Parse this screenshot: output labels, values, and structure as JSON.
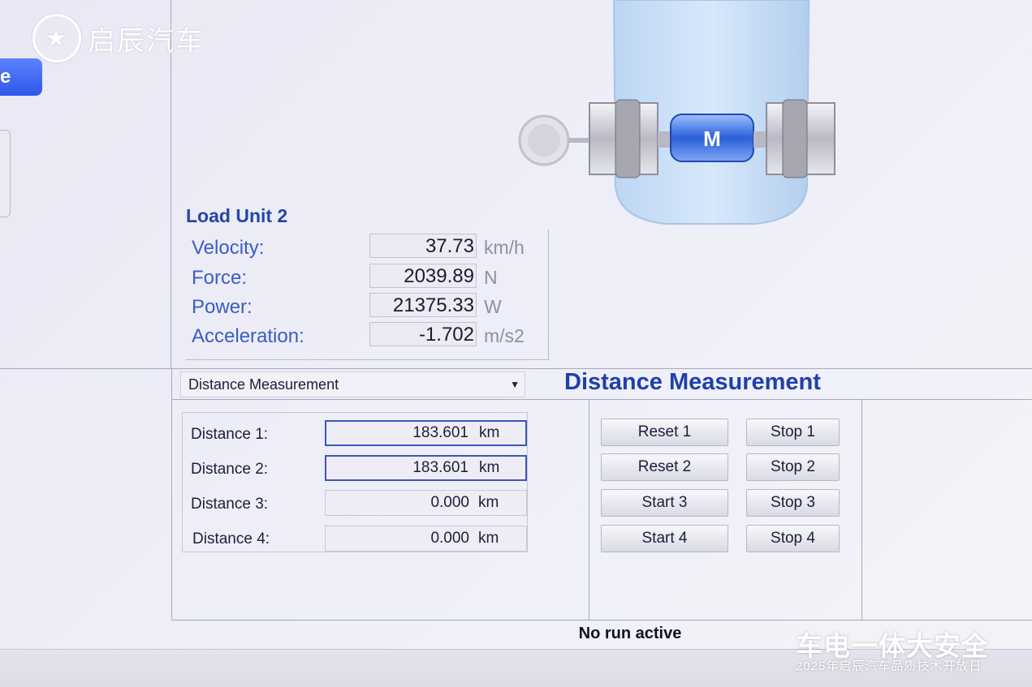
{
  "branding": {
    "logo_text": "启辰汽车",
    "watermark_title": "车电一体大安全",
    "watermark_subtitle": "2025年启辰汽车品质技术开放日"
  },
  "left_panel": {
    "button_partial_label": "e"
  },
  "diagram": {
    "motor_label": "M"
  },
  "load_unit": {
    "title": "Load Unit 2",
    "rows": [
      {
        "label": "Velocity:",
        "value": "37.73",
        "unit": "km/h"
      },
      {
        "label": "Force:",
        "value": "2039.89",
        "unit": "N"
      },
      {
        "label": "Power:",
        "value": "21375.33",
        "unit": "W"
      },
      {
        "label": "Acceleration:",
        "value": "-1.702",
        "unit": "m/s2"
      }
    ]
  },
  "measurement_select": {
    "selected": "Distance Measurement"
  },
  "section_title": "Distance Measurement",
  "distances": [
    {
      "label": "Distance 1:",
      "value": "183.601",
      "unit": "km"
    },
    {
      "label": "Distance 2:",
      "value": "183.601",
      "unit": "km"
    },
    {
      "label": "Distance 3:",
      "value": "0.000",
      "unit": "km"
    },
    {
      "label": "Distance 4:",
      "value": "0.000",
      "unit": "km"
    }
  ],
  "controls": [
    {
      "primary": "Reset 1",
      "secondary": "Stop 1"
    },
    {
      "primary": "Reset 2",
      "secondary": "Stop 2"
    },
    {
      "primary": "Start 3",
      "secondary": "Stop 3"
    },
    {
      "primary": "Start 4",
      "secondary": "Stop 4"
    }
  ],
  "status_text": "No run active",
  "colors": {
    "accent": "#2446a8",
    "label_blue": "#3a5cc4",
    "motor_blue": "#2a5fd8"
  }
}
